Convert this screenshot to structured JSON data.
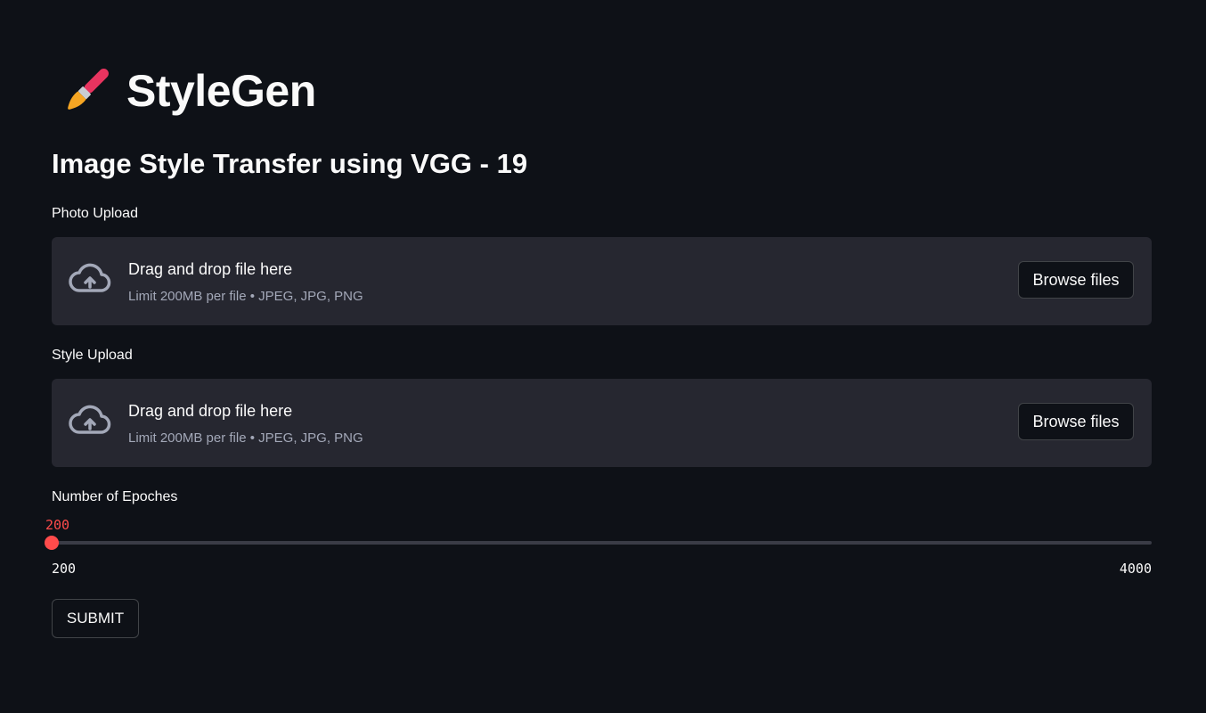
{
  "header": {
    "title": "StyleGen",
    "icon": "paintbrush-icon"
  },
  "subtitle": "Image Style Transfer using VGG - 19",
  "photo_upload": {
    "label": "Photo Upload",
    "drop_text": "Drag and drop file here",
    "limit_text": "Limit 200MB per file • JPEG, JPG, PNG",
    "button_label": "Browse files",
    "icon": "cloud-upload-icon"
  },
  "style_upload": {
    "label": "Style Upload",
    "drop_text": "Drag and drop file here",
    "limit_text": "Limit 200MB per file • JPEG, JPG, PNG",
    "button_label": "Browse files",
    "icon": "cloud-upload-icon"
  },
  "epochs_slider": {
    "label": "Number of Epoches",
    "value": 200,
    "value_text": "200",
    "min": 200,
    "max": 4000,
    "min_label": "200",
    "max_label": "4000"
  },
  "submit": {
    "label": "SUBMIT"
  },
  "colors": {
    "background": "#0e1117",
    "surface": "#262730",
    "accent": "#ff4b4b",
    "text": "#fafafa",
    "muted_text": "#a3a8b8"
  }
}
